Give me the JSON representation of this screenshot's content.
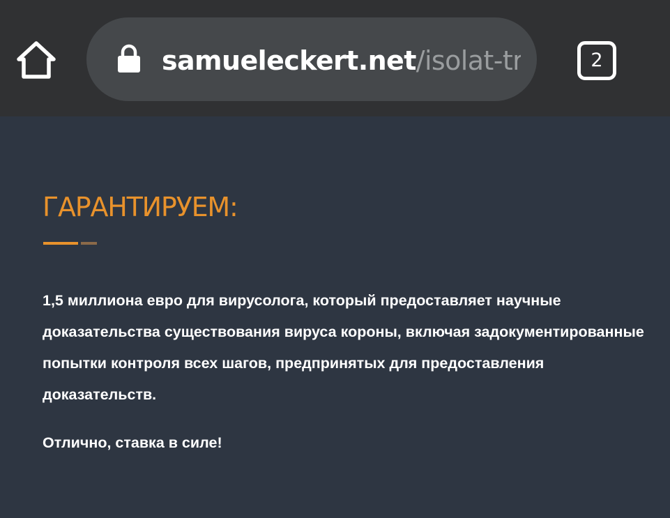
{
  "browser": {
    "url_host": "samueleckert.net",
    "url_path": "/isolat-tr",
    "tab_count": "2",
    "home_icon": "home-icon",
    "lock_icon": "lock-icon",
    "tabs_icon": "tab-switcher-icon"
  },
  "colors": {
    "topbar": "#303133",
    "urlbar": "#45484b",
    "page_background": "#2e3642",
    "accent": "#e8922c"
  },
  "page": {
    "heading": "ГАРАНТИРУЕМ:",
    "body": "1,5 миллиона евро для вирусолога, который предоставляет научные доказательства существования вируса короны, включая задокументированные попытки контроля всех шагов, предпринятых для предоставления доказательств.",
    "closing": "Отлично, ставка в силе!"
  }
}
